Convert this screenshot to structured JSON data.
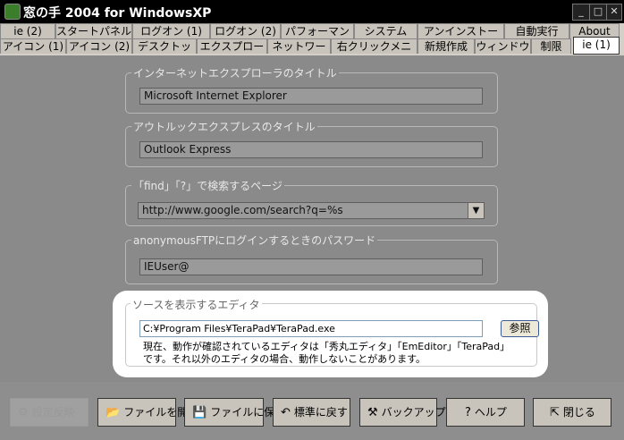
{
  "window": {
    "title": "窓の手 2004 for WindowsXP",
    "minimize": "_",
    "maximize": "□",
    "close": "✕"
  },
  "tabs_row1": [
    "ie (2)",
    "スタートパネル",
    "ログオン (1)",
    "ログオン (2)",
    "パフォーマンス",
    "システム",
    "アンインストール",
    "自動実行",
    "About"
  ],
  "tabs_row2": [
    "アイコン (1)",
    "アイコン (2)",
    "デスクトップ",
    "エクスプローラ",
    "ネットワーク",
    "右クリックメニュー",
    "新規作成",
    "ウィンドウ",
    "制限",
    "ie (1)"
  ],
  "groups": {
    "ie_title": {
      "label": "インターネットエクスプローラのタイトル",
      "value": "Microsoft Internet Explorer"
    },
    "oe_title": {
      "label": "アウトルックエクスプレスのタイトル",
      "value": "Outlook Express"
    },
    "find_page": {
      "label": "「find」「?」で検索するページ",
      "value": "http://www.google.com/search?q=%s"
    },
    "ftp_pass": {
      "label": "anonymousFTPにログインするときのパスワード",
      "value": "IEUser@"
    },
    "source_editor": {
      "label": "ソースを表示するエディタ",
      "value": "C:¥Program Files¥TeraPad¥TeraPad.exe",
      "browse": "参照",
      "description": "現在、動作が確認されているエディタは「秀丸エディタ」「EmEditor」「TeraPad」です。それ以外のエディタの場合、動作しないことがあります。"
    }
  },
  "buttons": {
    "apply": "設定反映",
    "open_file": "ファイルを開く",
    "save_file": "ファイルに保存",
    "reset": "標準に戻す",
    "backup": "バックアップ",
    "help": "ヘルプ",
    "close": "閉じる"
  },
  "icons": {
    "apply": "settings-icon",
    "open_file": "folder-open-icon",
    "save_file": "floppy-icon",
    "reset": "undo-icon",
    "backup": "backup-icon",
    "help": "question-icon",
    "close": "exit-icon"
  }
}
